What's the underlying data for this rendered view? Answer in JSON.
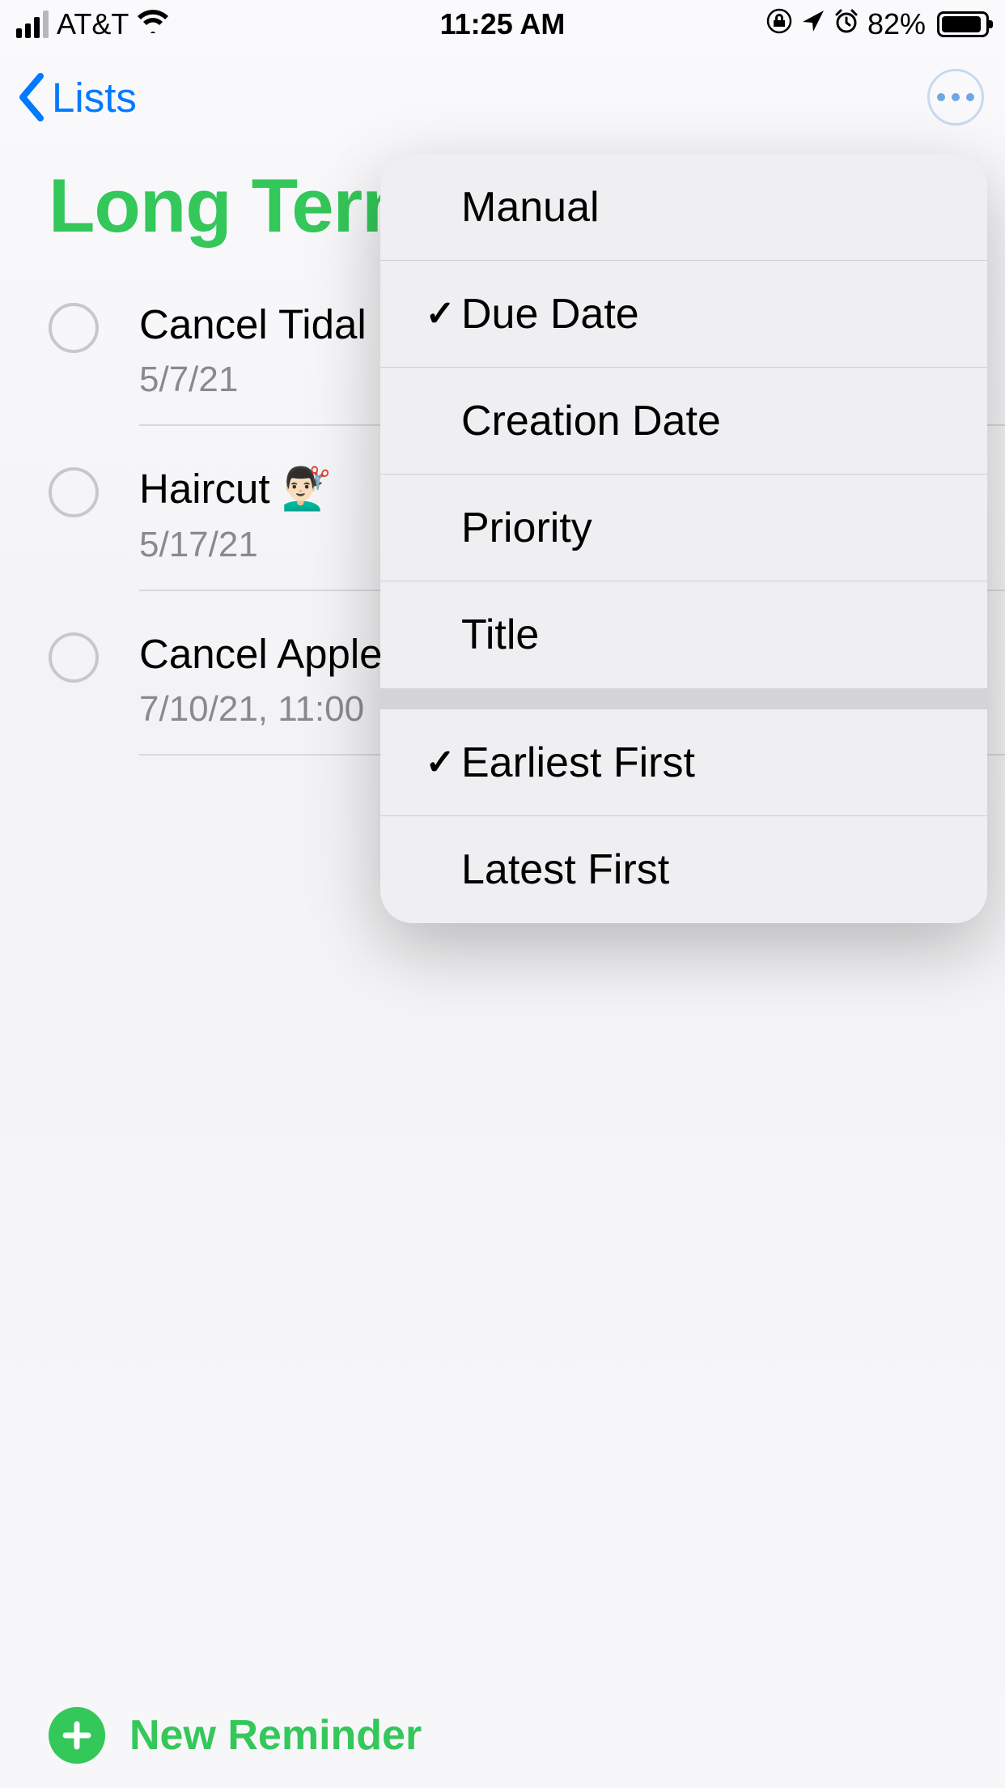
{
  "status": {
    "carrier": "AT&T",
    "time": "11:25 AM",
    "battery_percent": "82%"
  },
  "nav": {
    "back_label": "Lists"
  },
  "list": {
    "title": "Long Term",
    "accent_color": "#34c759"
  },
  "reminders": [
    {
      "title": "Cancel Tidal",
      "sub": "5/7/21"
    },
    {
      "title": "Haircut 💇🏻‍♂️",
      "sub": "5/17/21"
    },
    {
      "title": "Cancel Apple",
      "sub": "7/10/21, 11:00"
    }
  ],
  "sort_menu": {
    "sort_by": [
      {
        "label": "Manual",
        "checked": false
      },
      {
        "label": "Due Date",
        "checked": true
      },
      {
        "label": "Creation Date",
        "checked": false
      },
      {
        "label": "Priority",
        "checked": false
      },
      {
        "label": "Title",
        "checked": false
      }
    ],
    "order": [
      {
        "label": "Earliest First",
        "checked": true
      },
      {
        "label": "Latest First",
        "checked": false
      }
    ]
  },
  "footer": {
    "new_reminder": "New Reminder"
  }
}
